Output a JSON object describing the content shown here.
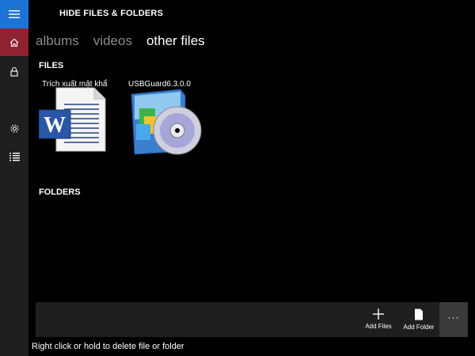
{
  "app": {
    "title": "HIDE FILES & FOLDERS"
  },
  "sidebar": {
    "items": [
      {
        "icon": "hamburger-menu-icon"
      },
      {
        "icon": "home-icon",
        "active": true
      },
      {
        "icon": "lock-icon"
      },
      {
        "icon": "gear-icon"
      },
      {
        "icon": "list-icon"
      }
    ]
  },
  "tabs": [
    {
      "label": "albums",
      "active": false
    },
    {
      "label": "videos",
      "active": false
    },
    {
      "label": "other files",
      "active": true
    }
  ],
  "files": {
    "heading": "FILES",
    "items": [
      {
        "name": "Trích xuất mật khẩ",
        "icon": "word-document-icon"
      },
      {
        "name": "USBGuard6.3.0.0",
        "icon": "installer-cd-icon"
      }
    ]
  },
  "folders": {
    "heading": "FOLDERS",
    "items": []
  },
  "appbar": {
    "add_files": "Add Files",
    "add_folder": "Add Folder",
    "more": "···"
  },
  "hint": "Right click or hold to delete file or folder",
  "colors": {
    "accent_blue": "#1e73d6",
    "home_red": "#8e2230",
    "sidebar_bg": "#1f1f1f",
    "bg": "#000000"
  }
}
